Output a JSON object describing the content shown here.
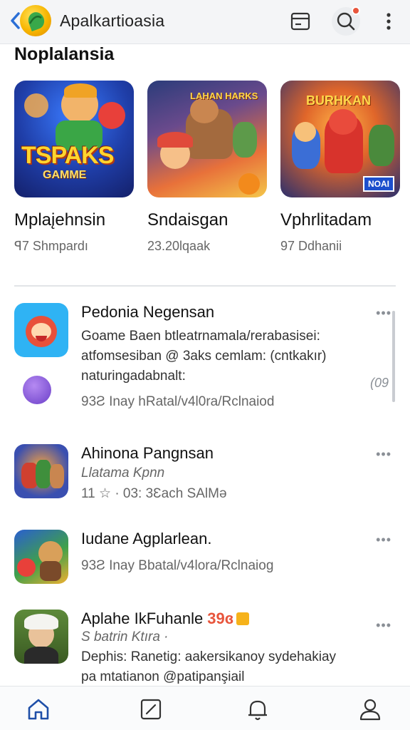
{
  "header": {
    "app_title": "Apalkartioasia",
    "back_icon": "chevron-left-icon",
    "card_icon": "card-icon",
    "search_icon": "search-icon",
    "more_icon": "more-vertical-icon",
    "accent": "#2b6fd6",
    "notification_color": "#e8553c"
  },
  "featured": {
    "title": "Noplalansia",
    "items": [
      {
        "name": "Mplaįehnsin",
        "meta": "ꟼ7 Shmpardı",
        "thumb_word": "TSPAKS",
        "thumb_sub": "GAMME"
      },
      {
        "name": "Sndaisgan",
        "meta": "23.20lqaak",
        "thumb_banner": "LAHAN HARKS"
      },
      {
        "name": "Vphrlitadam",
        "meta": "97 Ddhanii",
        "thumb_banner": "BURHKAN",
        "thumb_tag": "NOAI"
      }
    ]
  },
  "list": {
    "items": [
      {
        "title": "Pedonia Negensan",
        "line1": "Goame Baen btleatrnamala/rerabasisei:",
        "line2": "atfomsesiban @ 3aks cemlam: (cntkakır)",
        "line3": "naturingadabnalt:",
        "line4": "93Ƨ Inay hRatal/v4l0ra/Rclnaiod",
        "count": "(09"
      },
      {
        "title": "Ahinona Pangnsan",
        "line1": "Llatama Kpnn",
        "line2": "11 ☆ · 03: 3Ɛach SAlMə"
      },
      {
        "title": "Iudane Agplarlean.",
        "line1": "93Ƨ Inay Bbatal/v4lora/Rclnaiog"
      },
      {
        "title": "Aplahe IkFuhanle",
        "badge": "39ɞ",
        "line1": "S batrin Ktıra ·",
        "line2": "Dephis: Ranetig: aakersikanoy sydehakiay",
        "line3": "pa mtatianon @patipanşiail"
      }
    ]
  },
  "bottom_nav": {
    "items": [
      "home-icon",
      "edit-icon",
      "bell-icon",
      "profile-icon"
    ],
    "active_color": "#1f4fa8"
  }
}
